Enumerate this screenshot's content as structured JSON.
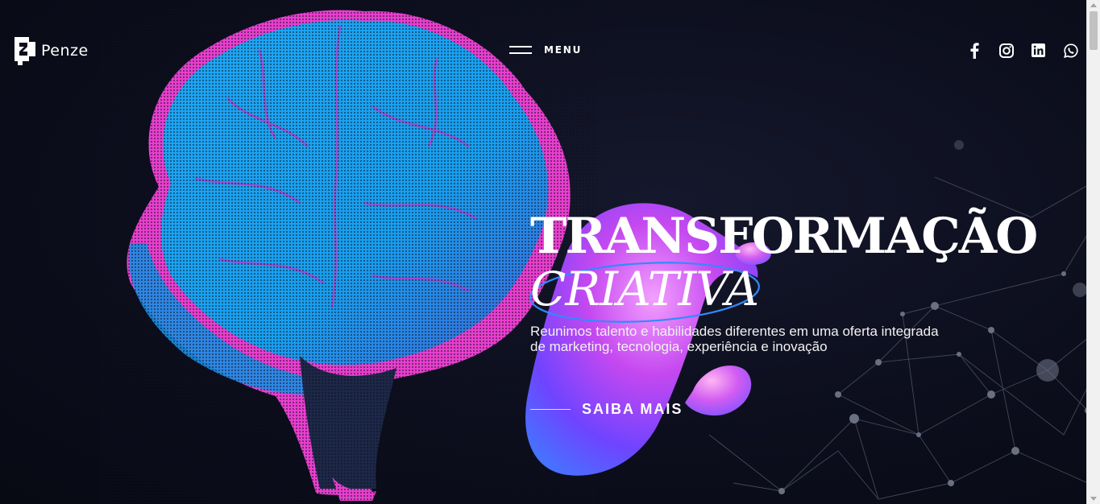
{
  "header": {
    "logo_text": "Penze",
    "menu_label": "MENU",
    "social": [
      "facebook-icon",
      "instagram-icon",
      "linkedin-icon",
      "whatsapp-icon"
    ]
  },
  "hero": {
    "title_line1": "TRANSFORMAÇÃO",
    "title_line2": "CRIATIVA",
    "subtitle": "Reunimos talento e habilidades diferentes em uma oferta integrada de marketing, tecnologia, experiência e inovação",
    "cta_label": "SAIBA MAIS"
  },
  "colors": {
    "background": "#0c0e1d",
    "brain_blue": "#1aa3f0",
    "brain_pink": "#f23fcf",
    "ellipse": "#2f8bff"
  }
}
